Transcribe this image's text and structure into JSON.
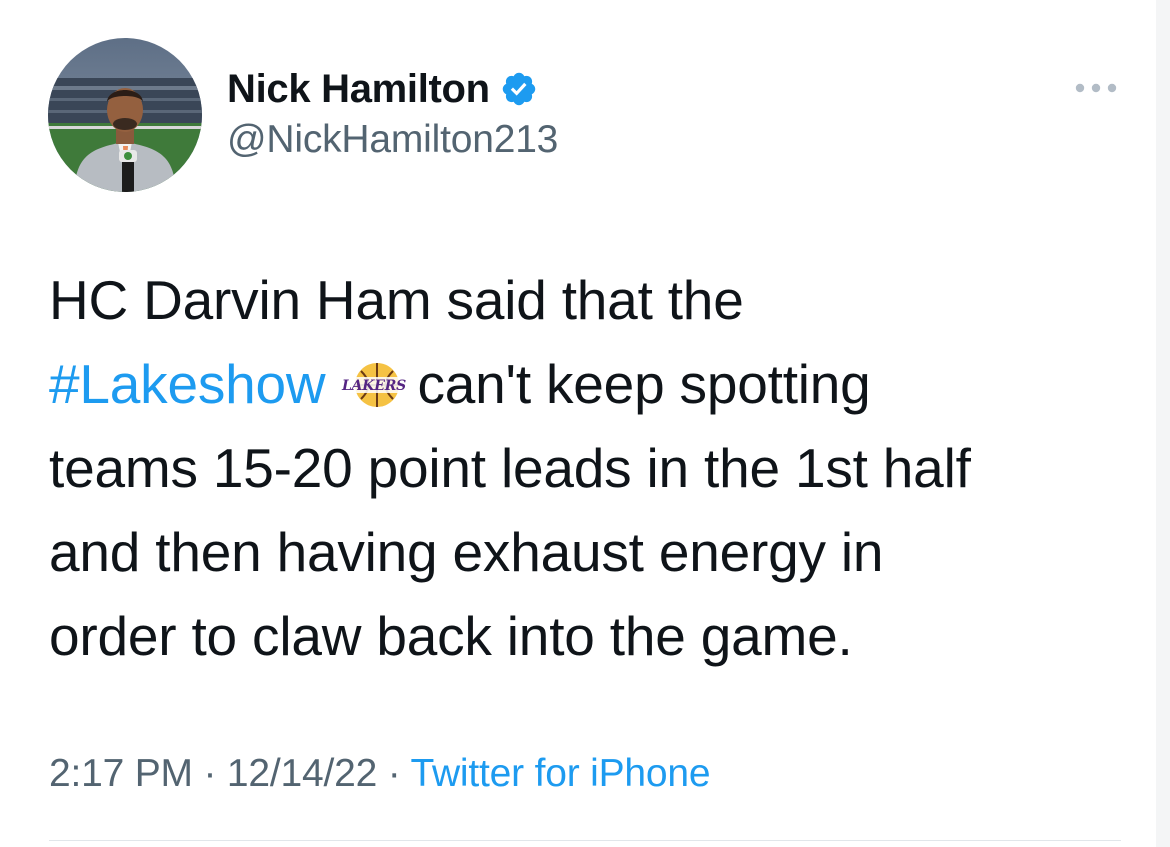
{
  "author": {
    "display_name": "Nick Hamilton",
    "handle": "@NickHamilton213",
    "verified": true,
    "avatar_icon": "profile-photo"
  },
  "more_icon": "ellipsis-icon",
  "tweet": {
    "line1": "HC Darvin Ham said that the",
    "hashtag": "#Lakeshow",
    "emoji": "lakers-logo-emoji",
    "line2_rest": "can't keep spotting",
    "line3": "teams 15-20 point leads in the 1st half",
    "line4": "and then having exhaust energy in",
    "line5": "order to claw back into the game."
  },
  "meta": {
    "time": "2:17 PM",
    "sep1": " · ",
    "date": "12/14/22",
    "sep2": " · ",
    "source": "Twitter for iPhone"
  },
  "colors": {
    "link": "#1d9bf0",
    "secondary_text": "#536471",
    "primary_text": "#0f1419"
  }
}
